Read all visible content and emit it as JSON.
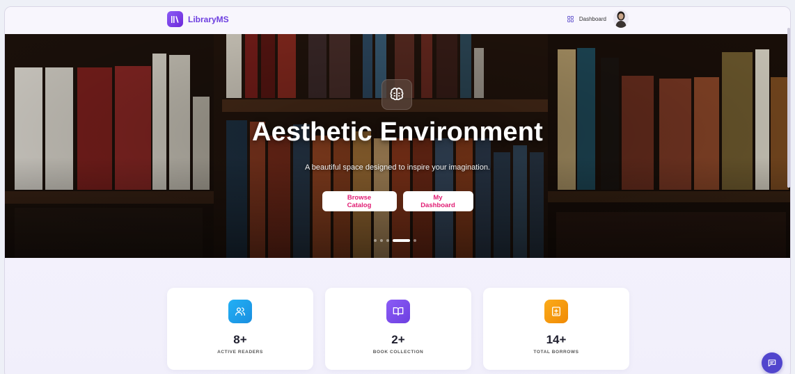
{
  "nav": {
    "brand_name": "LibraryMS",
    "dashboard_label": "Dashboard"
  },
  "hero": {
    "title": "Aesthetic Environment",
    "subtitle": "A beautiful space designed to inspire your imagination.",
    "browse_label": "Browse Catalog",
    "dashboard_label": "My Dashboard",
    "active_slide": 4,
    "slide_count": 5
  },
  "stats": [
    {
      "value": "8+",
      "label": "ACTIVE READERS",
      "icon": "users-icon",
      "color": "#1aa3f0"
    },
    {
      "value": "2+",
      "label": "BOOK COLLECTION",
      "icon": "book-open-icon",
      "color": "#7c4dea"
    },
    {
      "value": "14+",
      "label": "TOTAL BORROWS",
      "icon": "book-plus-icon",
      "color": "#f59e0b"
    }
  ],
  "colors": {
    "brand": "#6d3fe0",
    "button_text": "#e11d74",
    "chat": "#5145cd"
  }
}
